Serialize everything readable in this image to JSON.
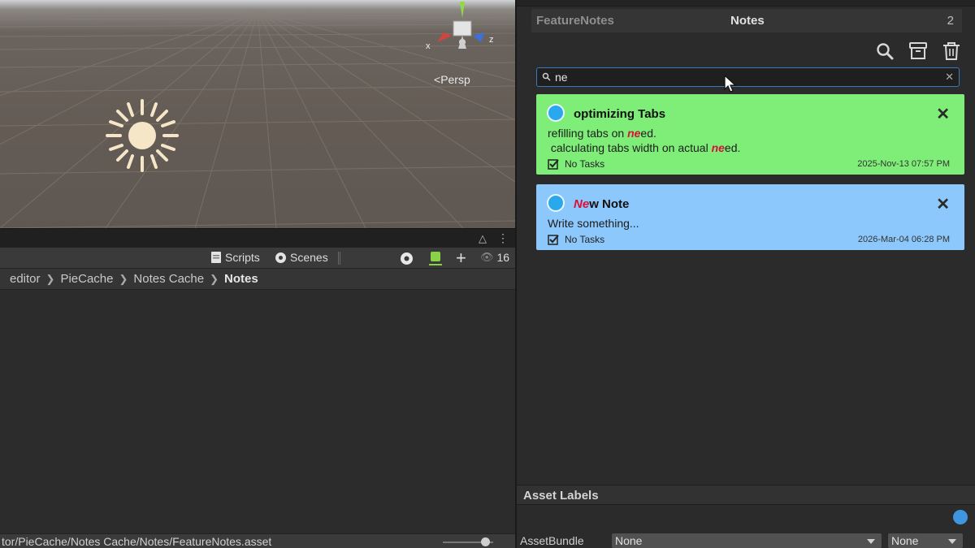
{
  "scene": {
    "persp_label": "Persp",
    "gizmo_axes": {
      "x": "x",
      "z": "z"
    }
  },
  "project": {
    "toolbar": {
      "scripts_label": "Scripts",
      "scenes_label": "Scenes",
      "visible_count": "16"
    },
    "breadcrumb": [
      "editor",
      "PieCache",
      "Notes Cache",
      "Notes"
    ],
    "status_path": "tor/PieCache/Notes Cache/Notes/FeatureNotes.asset"
  },
  "notes_panel": {
    "app_name": "FeatureNotes",
    "title": "Notes",
    "count": "2",
    "search": {
      "value": "ne"
    },
    "cards": [
      {
        "title": "optimizing Tabs",
        "line1_pre": "refilling tabs on ",
        "line1_hl": "ne",
        "line1_post": "ed.",
        "line2_pre": " calculating tabs width on actual ",
        "line2_hl": "ne",
        "line2_post": "ed.",
        "tasks": "No Tasks",
        "date": "2025-Nov-13 07:57 PM",
        "color": "#7eee78"
      },
      {
        "title_hl": "Ne",
        "title_post": "w Note",
        "body": "Write something...",
        "tasks": "No Tasks",
        "date": "2026-Mar-04 06:28 PM",
        "color": "#8cc8fb"
      }
    ]
  },
  "inspector": {
    "asset_labels_title": "Asset Labels",
    "assetbundle_label": "AssetBundle",
    "bundle_name": "None",
    "bundle_variant": "None"
  }
}
